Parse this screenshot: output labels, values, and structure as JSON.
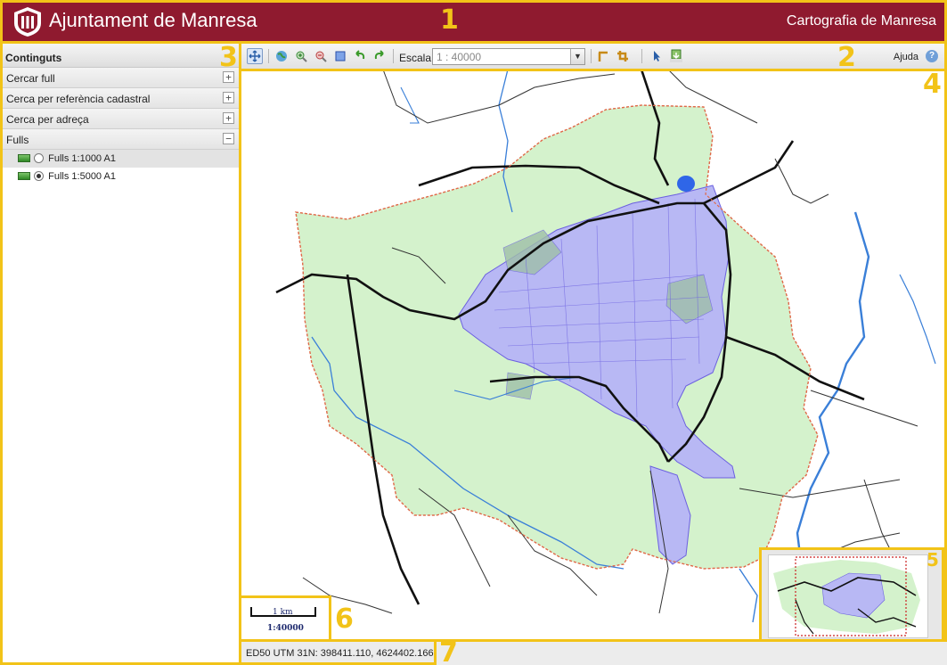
{
  "header": {
    "app_title": "Ajuntament de Manresa",
    "site_title": "Cartografia de Manresa",
    "brand_color": "#8f1a2f"
  },
  "annotations": [
    "1",
    "2",
    "3",
    "4",
    "5",
    "6",
    "7"
  ],
  "sidebar": {
    "title": "Continguts",
    "items": [
      {
        "label": "Cercar full",
        "toggle": "+"
      },
      {
        "label": "Cerca per referència cadastral",
        "toggle": "+"
      },
      {
        "label": "Cerca per adreça",
        "toggle": "+"
      },
      {
        "label": "Fulls",
        "toggle": "−"
      }
    ],
    "layers": [
      {
        "label": "Fulls 1:1000 A1",
        "selected": false
      },
      {
        "label": "Fulls 1:5000 A1",
        "selected": true
      }
    ]
  },
  "toolbar": {
    "icons": [
      "pan-icon",
      "globe-icon",
      "zoom-in-icon",
      "zoom-out-icon",
      "zoom-box-icon",
      "undo-icon",
      "redo-icon",
      "measure-icon",
      "crop-icon",
      "select-icon",
      "dxf-download-icon"
    ],
    "scale_label": "Escala",
    "scale_value": "1 : 40000",
    "help_label": "Ajuda"
  },
  "map": {
    "scalebar_distance": "1 km",
    "scalebar_ratio": "1:40000",
    "colors": {
      "municipal_area": "#d4f2cc",
      "urban_area": "#b8b8f4",
      "river": "#3a7fd8",
      "boundary": "#e06a4a"
    }
  },
  "status": {
    "coordinates": "ED50 UTM 31N: 398411.110, 4624402.166"
  }
}
